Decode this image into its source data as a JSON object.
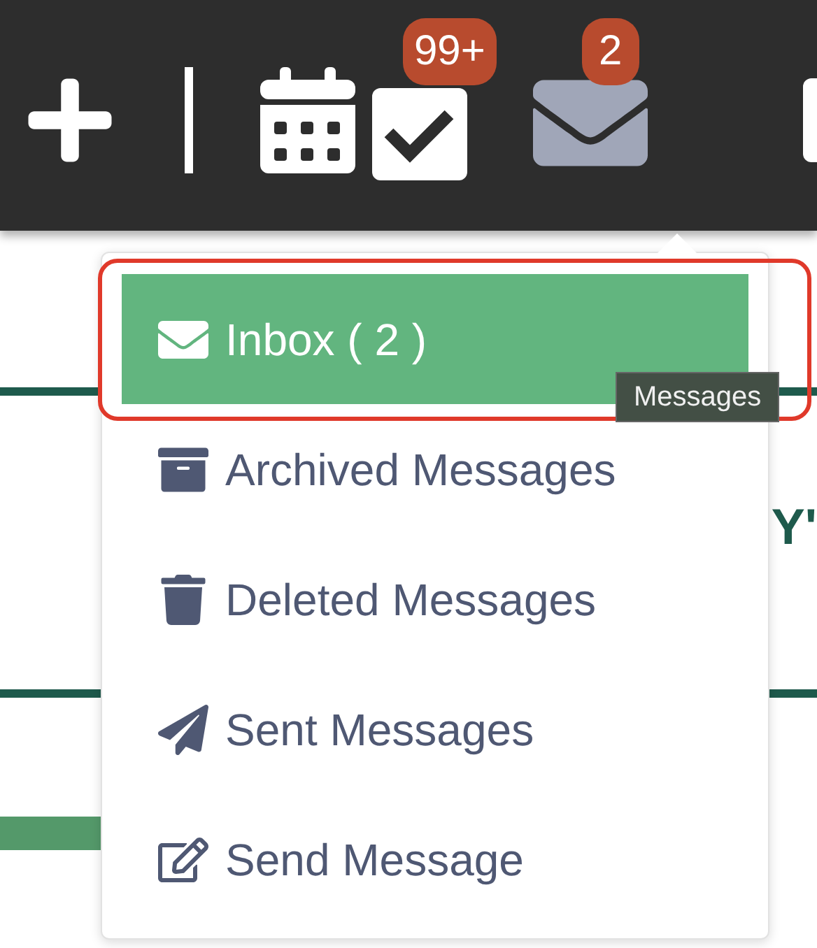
{
  "toolbar": {
    "items": [
      {
        "kind": "add",
        "selected": false
      },
      {
        "kind": "divider",
        "selected": false
      },
      {
        "kind": "calendar",
        "selected": false
      },
      {
        "kind": "tasks",
        "selected": false,
        "badge": "99+"
      },
      {
        "kind": "messages",
        "selected": true,
        "badge": "2"
      },
      {
        "kind": "partial",
        "selected": false
      }
    ]
  },
  "background": {
    "heading_fragment": "Y'"
  },
  "menu": {
    "items": [
      {
        "kind": "inbox",
        "label": "Inbox ( 2 )",
        "selected": true
      },
      {
        "kind": "archive",
        "label": "Archived Messages",
        "selected": false
      },
      {
        "kind": "trash",
        "label": "Deleted Messages",
        "selected": false
      },
      {
        "kind": "sent",
        "label": "Sent Messages",
        "selected": false
      },
      {
        "kind": "compose",
        "label": "Send Message",
        "selected": false
      }
    ]
  },
  "tooltip": {
    "text": "Messages"
  }
}
